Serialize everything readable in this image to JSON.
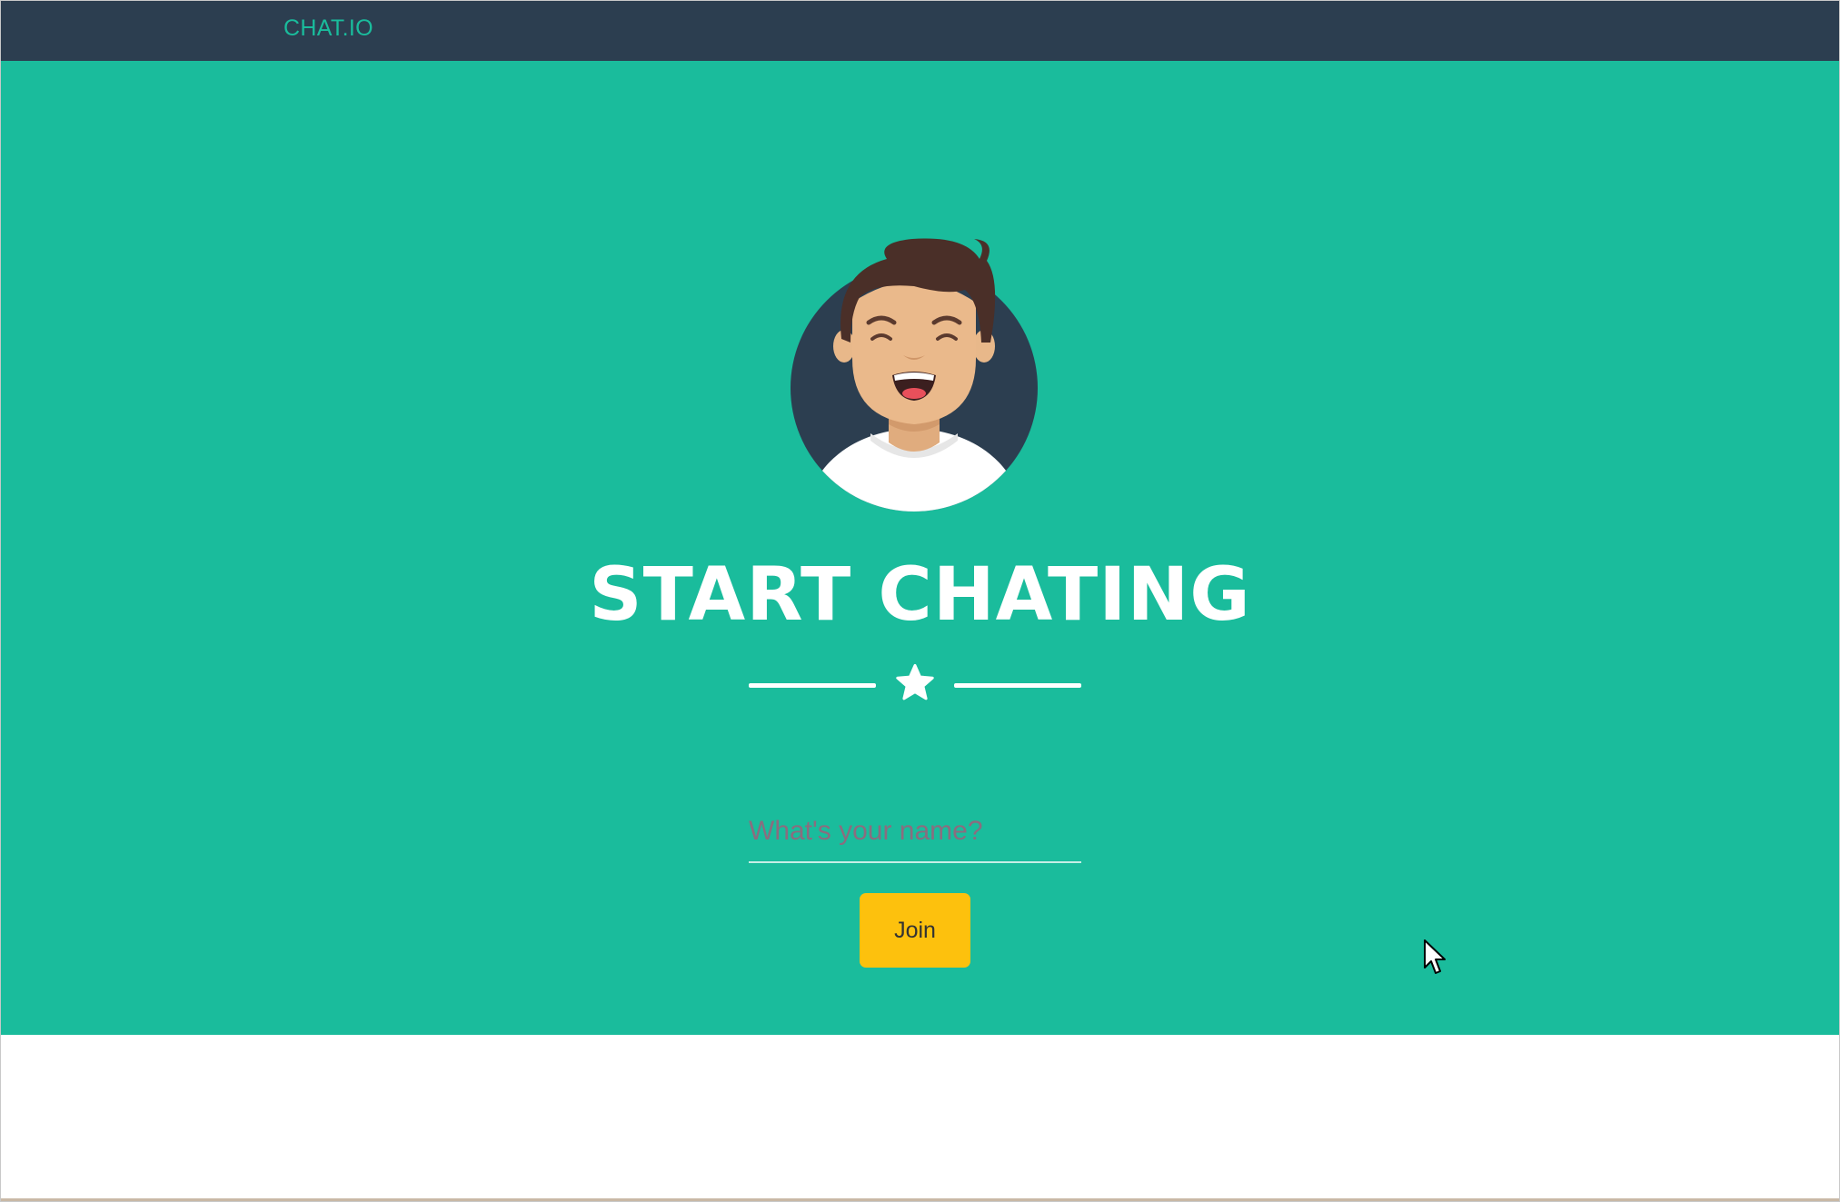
{
  "navbar": {
    "brand": "CHAT.IO"
  },
  "hero": {
    "title": "START CHATING",
    "name_input": {
      "value": "",
      "placeholder": "What's your name?"
    },
    "join_label": "Join"
  },
  "icons": {
    "avatar": "smiling-man-avatar",
    "divider": "star-icon",
    "pointer": "mouse-cursor-icon"
  },
  "colors": {
    "navbar": "#2c3e50",
    "brand": "#1abc9c",
    "hero": "#1abc9c",
    "button": "#fdc10d",
    "text_light": "#ffffff"
  }
}
